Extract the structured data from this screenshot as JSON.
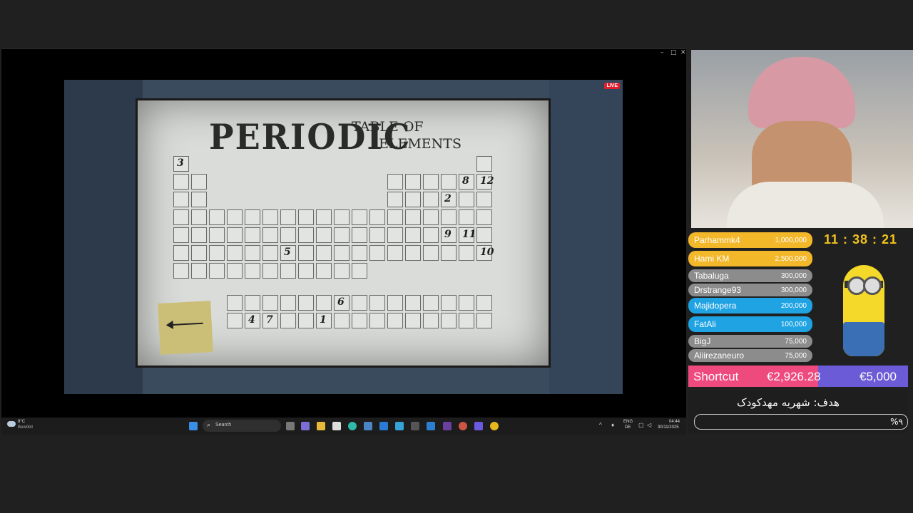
{
  "game": {
    "poster_title_main": "PERIODIC",
    "poster_title_line1": "TABLE OF",
    "poster_title_line2": "ELEMENTS",
    "live_badge": "LIVE",
    "numbers": [
      "3",
      "8",
      "12",
      "2",
      "9",
      "11",
      "5",
      "10",
      "6",
      "4",
      "7",
      "1"
    ]
  },
  "taskbar": {
    "weather_temp": "8°C",
    "weather_desc": "Bewölkt",
    "search_placeholder": "Search",
    "lang1": "ENG",
    "lang2": "DE",
    "time": "04:44",
    "date": "30/11/2025"
  },
  "leaderboard": [
    {
      "name": "Parhammk4",
      "amount": "1,000,000",
      "color": "#f3b72a"
    },
    {
      "name": "Hami KM",
      "amount": "2,500,000",
      "color": "#f3b72a"
    },
    {
      "name": "Tabaluga",
      "amount": "300,000",
      "color": "#8c8c8c"
    },
    {
      "name": "Drstrange93",
      "amount": "300,000",
      "color": "#8c8c8c"
    },
    {
      "name": "Majidopera",
      "amount": "200,000",
      "color": "#1fa3e3"
    },
    {
      "name": "FatAli",
      "amount": "100,000",
      "color": "#1fa3e3"
    },
    {
      "name": "BigJ",
      "amount": "75,000",
      "color": "#8c8c8c"
    },
    {
      "name": "Aliirezaneuro",
      "amount": "75,000",
      "color": "#8c8c8c"
    }
  ],
  "timer": "11 : 38 : 21",
  "goal": {
    "label": "Shortcut",
    "current": "€2,926.28",
    "target": "€5,000",
    "title": "هدف: شهریه مهدکودک",
    "percent": "%۹",
    "progress": 0.59
  }
}
